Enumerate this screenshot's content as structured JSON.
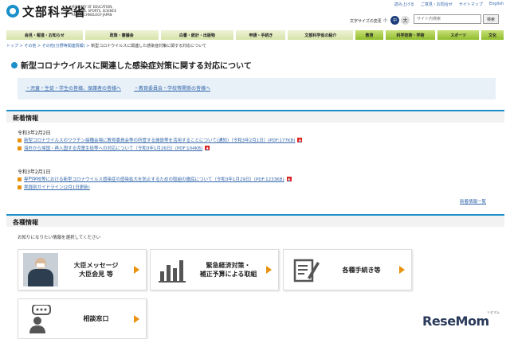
{
  "header": {
    "logo_text": "文部科学省",
    "logo_en": "MINISTRY OF EDUCATION, CULTURE, SPORTS, SCIENCE AND TECHNOLOGY-JAPAN",
    "util_links": [
      "読み上げる",
      "ご意見・お問合せ",
      "サイトマップ",
      "English"
    ],
    "font_size_label": "文字サイズの変更",
    "font_sizes": [
      "小",
      "中",
      "大"
    ],
    "search_placeholder": "サイト内検索",
    "search_button": "検索"
  },
  "nav": [
    "会見・報道・お知らせ",
    "政策・審議会",
    "白書・統計・出版物",
    "申請・手続き",
    "文部科学省の紹介",
    "教育",
    "科学技術・学術",
    "スポーツ",
    "文化"
  ],
  "breadcrumb": {
    "items": [
      "トップ",
      "その他",
      "その他(分野等関連情報)"
    ],
    "current": "新型コロナウイルスに関連した感染症対策に関する対応について"
  },
  "page_title": "新型コロナウイルスに関連した感染症対策に関する対応について",
  "links": [
    "・児童・生徒・学生の皆様、保護者の皆様へ",
    "・教育委員会・学校等関係の皆様へ"
  ],
  "news": {
    "heading": "新着情報",
    "groups": [
      {
        "date": "令和3年2月2日",
        "items": [
          "新型コロナウイルスのワクチン接種会場に教育委員会等の所管する施設等を活用することについて(通知)（令和3年2月1日）(PDF:177KB)",
          "海外から帰国・再入国する児童生徒等への対応について（令和3年1月26日）(PDF:104KB)"
        ]
      },
      {
        "date": "令和3年2月1日",
        "items": [
          "専門学校等における新型コロナウイルス感染症の感染拡大を防止するための取組の徹底について（令和3年1月29日）(PDF:1233KB)",
          "実践別ガイドライン(2月1日更新)"
        ]
      }
    ],
    "more": "新着情報一覧"
  },
  "info": {
    "heading": "各種情報",
    "description": "お知りになりたい情報を選択してください",
    "cards": [
      {
        "label": "大臣メッセージ\n大臣会見 等",
        "icon": "minister-photo"
      },
      {
        "label": "緊急経済対策・\n補正予算による取組",
        "icon": "bar-chart-icon"
      },
      {
        "label": "各種手続き等",
        "icon": "document-pen-icon"
      },
      {
        "label": "相談窓口",
        "icon": "consultation-icon"
      }
    ]
  },
  "watermark": {
    "text": "ReseMom",
    "sub": "リセマム"
  },
  "colors": {
    "accent": "#1a8fc9",
    "link": "#3366aa",
    "arrow": "#e8920e",
    "nav_green": "#8fbd2a"
  }
}
